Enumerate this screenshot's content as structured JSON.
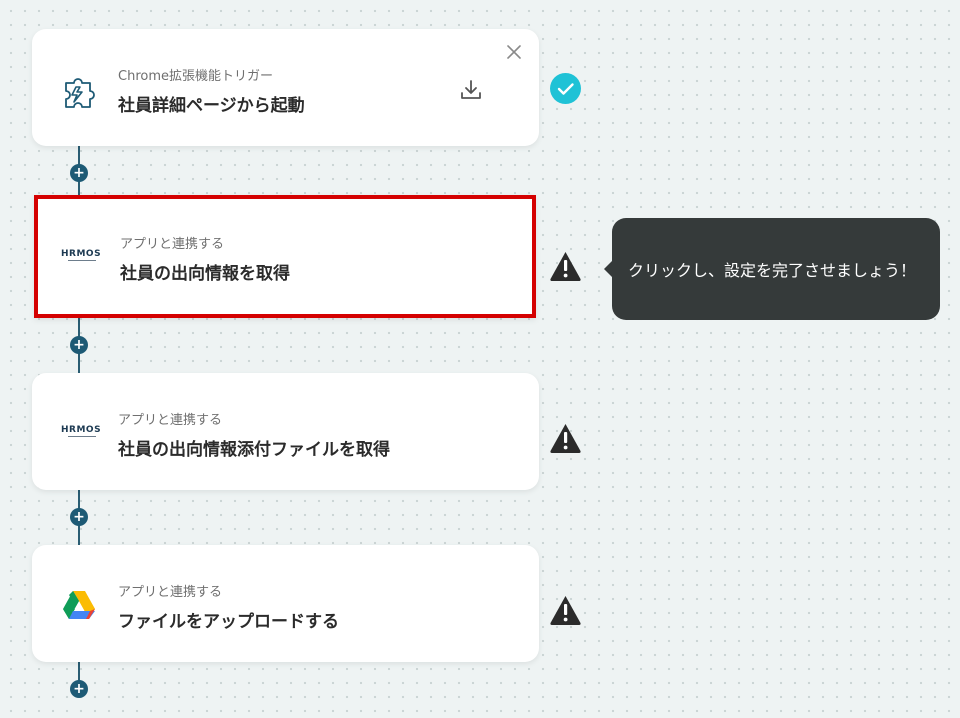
{
  "flow": {
    "steps": [
      {
        "subtitle": "Chrome拡張機能トリガー",
        "title": "社員詳細ページから起動",
        "icon": "puzzle-bolt-icon",
        "status": "complete"
      },
      {
        "subtitle": "アプリと連携する",
        "title": "社員の出向情報を取得",
        "icon": "hrmos-logo",
        "logo_text": "HRMOS",
        "status": "warning"
      },
      {
        "subtitle": "アプリと連携する",
        "title": "社員の出向情報添付ファイルを取得",
        "icon": "hrmos-logo",
        "logo_text": "HRMOS",
        "status": "warning"
      },
      {
        "subtitle": "アプリと連携する",
        "title": "ファイルをアップロードする",
        "icon": "google-drive-icon",
        "status": "warning"
      }
    ],
    "add_step_symbol": "+"
  },
  "tooltip": {
    "text": "クリックし、設定を完了させましょう！"
  },
  "colors": {
    "background": "#eef3f3",
    "connector": "#1d5a75",
    "selected_border": "#d40000",
    "success": "#1fc2d6",
    "warning": "#2b2b2b",
    "tooltip_bg": "#353a3a"
  }
}
